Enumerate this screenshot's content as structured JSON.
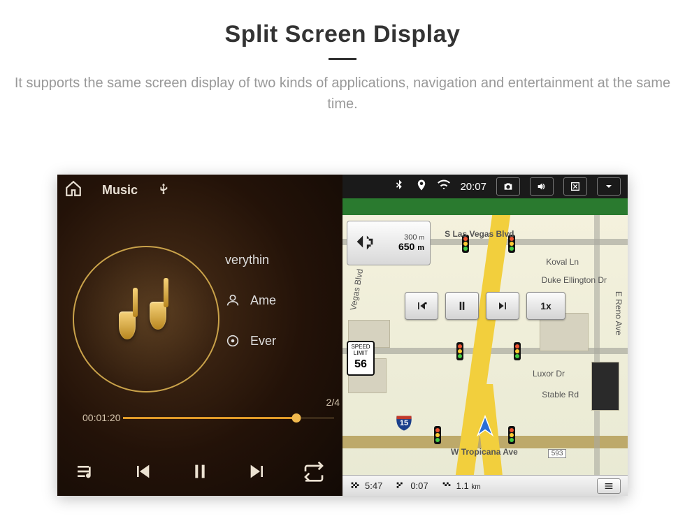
{
  "page": {
    "title": "Split Screen Display",
    "subtitle": "It supports the same screen display of two kinds of applications, navigation and entertainment at the same time."
  },
  "music": {
    "app_label": "Music",
    "tracks": {
      "row1_text": "verythin",
      "row2_text": "Ame",
      "row3_text": "Ever"
    },
    "elapsed": "00:01:20",
    "track_index": "2/4"
  },
  "statusbar": {
    "time": "20:07"
  },
  "nav": {
    "turncard": {
      "primary_dist": "650",
      "primary_unit": "m",
      "secondary_dist": "300",
      "secondary_unit": "m"
    },
    "speed_sign": {
      "line1": "SPEED",
      "line2": "LIMIT",
      "value": "56"
    },
    "interstate": "15",
    "play_speed": "1x",
    "streets": {
      "top": "S Las Vegas Blvd",
      "koval": "Koval Ln",
      "duke": "Duke Ellington Dr",
      "vegas": "Vegas Blvd",
      "luxor": "Luxor Dr",
      "stable": "Stable Rd",
      "reno": "E Reno Ave",
      "tropicana": "W Tropicana Ave",
      "tropicana_num": "593"
    },
    "bottombar": {
      "time": "5:47",
      "progress": "0:07",
      "distance_value": "1.1",
      "distance_unit": "km"
    }
  }
}
